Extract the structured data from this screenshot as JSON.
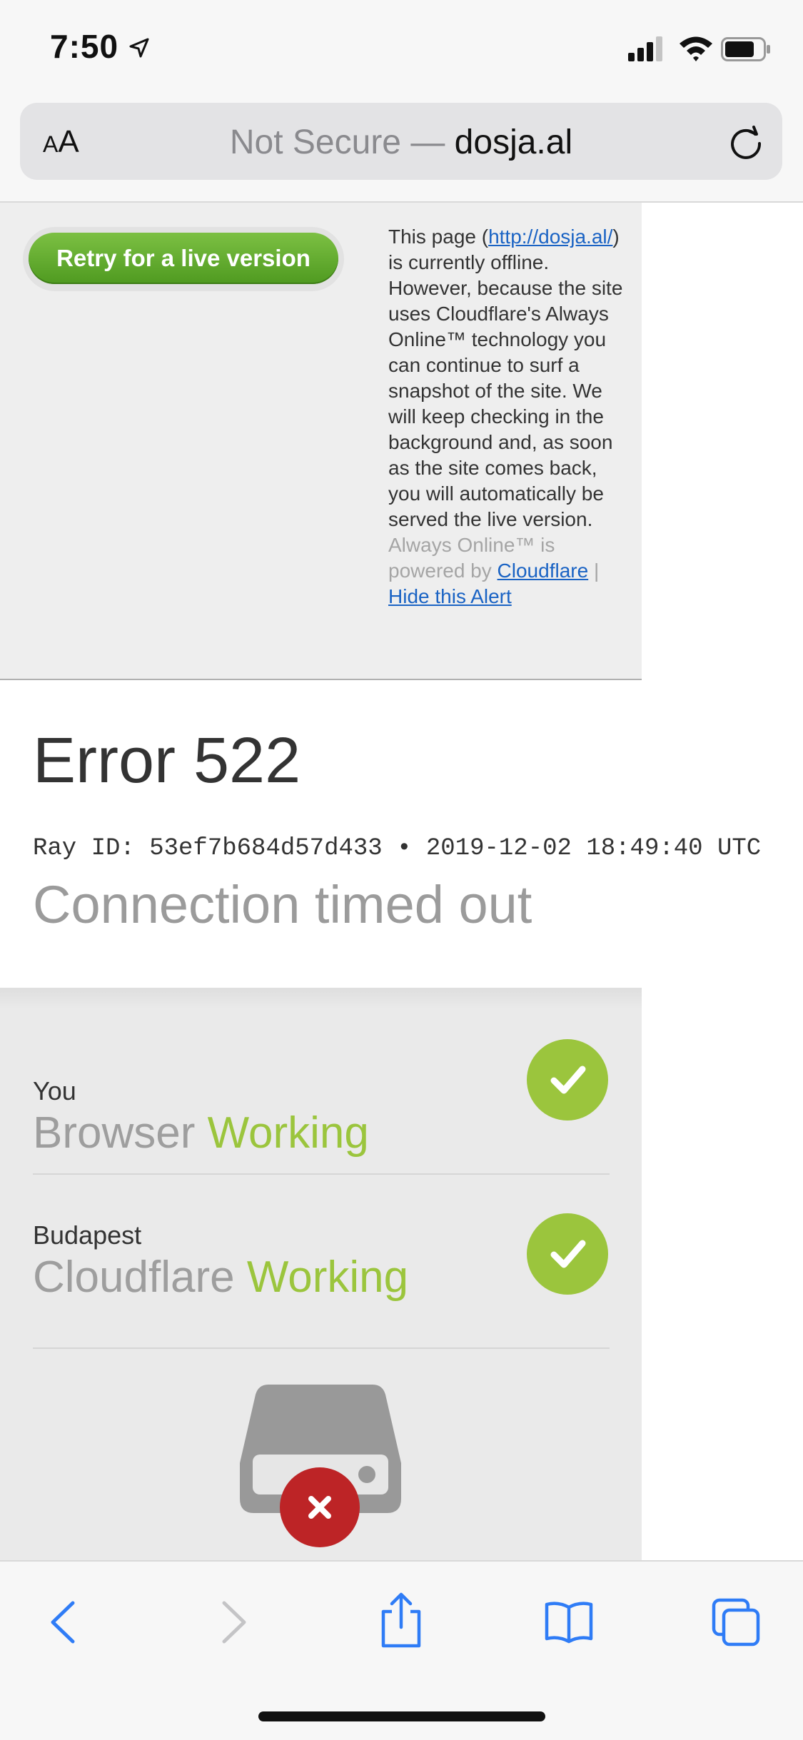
{
  "status_bar": {
    "time": "7:50"
  },
  "url_bar": {
    "aa_small": "A",
    "aa_large": "A",
    "not_secure": "Not Secure — ",
    "host": "dosja.al"
  },
  "banner": {
    "retry_label": "Retry for a live version",
    "text_pre_link": "This page (",
    "page_link": "http://dosja.al/",
    "text_post_link": ") is currently offline. However, because the site uses Cloudflare's Always Online™ technology you can continue to surf a snapshot of the site. We will keep checking in the background and, as soon as the site comes back, you will automatically be served the live version.",
    "powered_pre": "Always Online™ is powered by ",
    "cloudflare_link": "Cloudflare",
    "separator": " | ",
    "hide_link": "Hide this Alert"
  },
  "error": {
    "title": "Error 522",
    "ray": "Ray ID: 53ef7b684d57d433 • 2019-12-02 18:49:40 UTC",
    "subtitle": "Connection timed out"
  },
  "status_rows": [
    {
      "location": "You",
      "name": "Browser",
      "status": "Working"
    },
    {
      "location": "Budapest",
      "name": "Cloudflare",
      "status": "Working"
    }
  ],
  "colors": {
    "working_green": "#9bc53d",
    "error_red": "#bd2426",
    "link_blue": "#1a63c4",
    "ios_blue": "#2f7cf6"
  },
  "icons": {
    "location": "location-arrow-icon",
    "signal": "cellular-signal-icon",
    "wifi": "wifi-icon",
    "battery": "battery-icon",
    "reload": "reload-icon",
    "check": "checkmark-icon",
    "server": "server-drive-icon",
    "error": "error-x-icon",
    "back": "chevron-left-icon",
    "forward": "chevron-right-icon",
    "share": "share-icon",
    "bookmarks": "book-icon",
    "tabs": "tabs-icon"
  }
}
